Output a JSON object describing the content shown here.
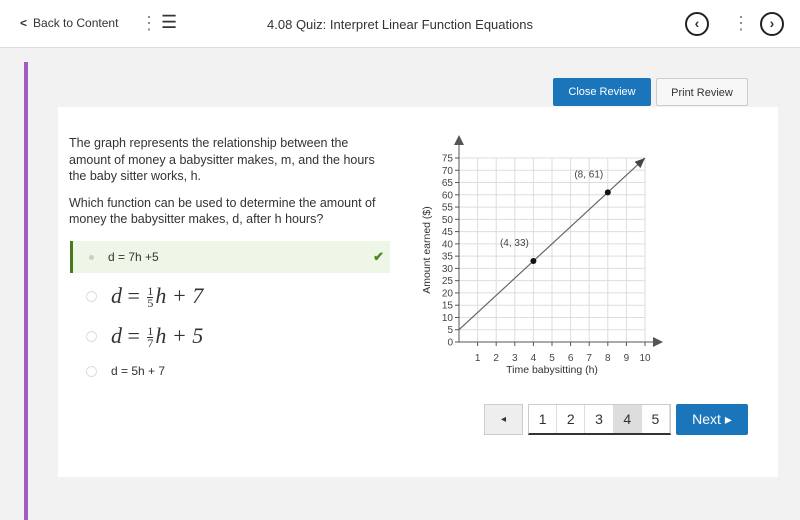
{
  "header": {
    "back_label": "Back to Content",
    "title": "4.08 Quiz: Interpret Linear Function Equations",
    "prev_icon": "‹",
    "next_icon": "›"
  },
  "review": {
    "close_label": "Close Review",
    "print_label": "Print Review"
  },
  "question": {
    "p1": "The graph represents the relationship between the amount of money a babysitter makes, m, and the hours the baby sitter works, h.",
    "p2": "Which function can be used to determine the amount of money the babysitter makes, d, after h hours?"
  },
  "options": [
    {
      "text": "d = 7h +5",
      "selected": true,
      "correct": true
    },
    {
      "lhs": "d",
      "num": "1",
      "den": "5",
      "rest": "h + 7"
    },
    {
      "lhs": "d",
      "num": "1",
      "den": "7",
      "rest": "h + 5"
    },
    {
      "text": "d = 5h + 7"
    }
  ],
  "chart_data": {
    "type": "line",
    "xlabel": "Time babysitting (h)",
    "ylabel": "Amount earned ($)",
    "xlim": [
      0,
      10
    ],
    "ylim": [
      0,
      75
    ],
    "xticks": [
      1,
      2,
      3,
      4,
      5,
      6,
      7,
      8,
      9,
      10
    ],
    "yticks": [
      0,
      5,
      10,
      15,
      20,
      25,
      30,
      35,
      40,
      45,
      50,
      55,
      60,
      65,
      70,
      75
    ],
    "grid": true,
    "line": {
      "x": [
        0,
        10
      ],
      "y": [
        5,
        75
      ]
    },
    "points": [
      {
        "x": 4,
        "y": 33,
        "label": "(4, 33)"
      },
      {
        "x": 8,
        "y": 61,
        "label": "(8, 61)"
      }
    ]
  },
  "pagination": {
    "prev_icon": "◂",
    "pages": [
      "1",
      "2",
      "3",
      "4",
      "5"
    ],
    "current": "4",
    "next_label": "Next ▸"
  },
  "colors": {
    "accent": "#1b75bb",
    "correct": "#4a7a1e",
    "sidebar": "#a35bc6"
  }
}
